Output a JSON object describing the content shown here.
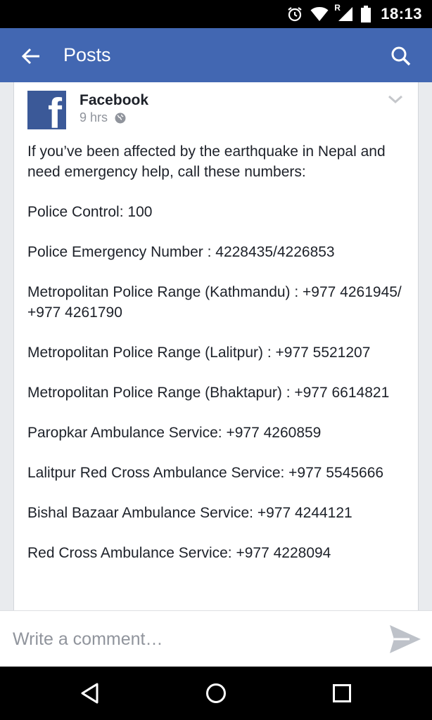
{
  "status_bar": {
    "time": "18:13",
    "icons": [
      "alarm-icon",
      "wifi-icon",
      "signal-roaming-icon",
      "battery-icon"
    ],
    "roaming_letter": "R"
  },
  "app_bar": {
    "title": "Posts",
    "background": "#4267b2",
    "icons": [
      "back-arrow-icon",
      "search-icon"
    ]
  },
  "post": {
    "author": "Facebook",
    "time": "9 hrs",
    "privacy_icon": "globe-icon",
    "logo_letter": "f",
    "logo_color": "#3b5998",
    "paragraphs": [
      "If you’ve been affected by the earthquake in Nepal and need emergency help, call these numbers:",
      "Police Control: 100",
      "Police Emergency Number : 4228435/4226853",
      "Metropolitan Police Range (Kathmandu) : +977 4261945/ +977 4261790",
      "Metropolitan Police Range (Lalitpur) : +977 5521207",
      "Metropolitan Police Range (Bhaktapur) : +977 6614821",
      "Paropkar Ambulance Service: +977 4260859",
      "Lalitpur Red Cross Ambulance Service: +977 5545666",
      "Bishal Bazaar Ambulance Service: +977 4244121",
      "Red Cross Ambulance Service: +977 4228094"
    ]
  },
  "comment_bar": {
    "placeholder": "Write a comment…",
    "send_icon": "send-icon"
  },
  "nav_bar": {
    "icons": [
      "nav-back-icon",
      "nav-home-icon",
      "nav-recents-icon"
    ]
  }
}
